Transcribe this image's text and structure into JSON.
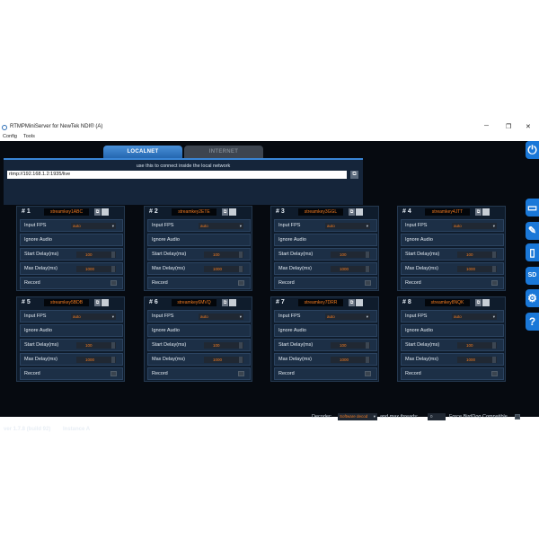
{
  "window": {
    "title": "RTMPMiniServer for NewTek NDI® (A)",
    "minimize": "─",
    "maximize": "❐",
    "close": "✕"
  },
  "menu": [
    "Config",
    "Tools"
  ],
  "tabs": [
    {
      "label": "LOCALNET",
      "active": true
    },
    {
      "label": "INTERNET",
      "active": false
    }
  ],
  "network": {
    "hint": "use this to connect inside the local network",
    "url": "rtmp://192.168.1.2:1935/live"
  },
  "field_labels": {
    "input_fps": "Input FPS",
    "ignore_audio": "Ignore Audio",
    "start_delay": "Start Delay(ms)",
    "max_delay": "Max Delay(ms)",
    "record": "Record"
  },
  "instances": [
    {
      "num": "# 1",
      "key": "streamkey1ABC",
      "fps": "auto",
      "start_delay": "100",
      "max_delay": "1000"
    },
    {
      "num": "# 2",
      "key": "streamkey2ETE",
      "fps": "auto",
      "start_delay": "100",
      "max_delay": "1000"
    },
    {
      "num": "# 3",
      "key": "streamkey3GGL",
      "fps": "auto",
      "start_delay": "100",
      "max_delay": "1000"
    },
    {
      "num": "# 4",
      "key": "streamkey4JTT",
      "fps": "auto",
      "start_delay": "100",
      "max_delay": "1000"
    },
    {
      "num": "# 5",
      "key": "streamkey5BDB",
      "fps": "auto",
      "start_delay": "100",
      "max_delay": "1000"
    },
    {
      "num": "# 6",
      "key": "streamkey6MVQ",
      "fps": "auto",
      "start_delay": "100",
      "max_delay": "1000"
    },
    {
      "num": "# 7",
      "key": "streamkey7DRR",
      "fps": "auto",
      "start_delay": "100",
      "max_delay": "1000"
    },
    {
      "num": "# 8",
      "key": "streamkey8NQK",
      "fps": "auto",
      "start_delay": "100",
      "max_delay": "1000"
    }
  ],
  "footer": {
    "decoder_label": "Decoder:",
    "decoder_value": "Software decod",
    "threads_label": "and max.threads:",
    "threads_value": "0",
    "birddog_label": "Force BirdDog Compatible",
    "version": "ver 1.7.8 (build 92)",
    "instance": "Instance A"
  },
  "sidebar": [
    {
      "icon": "power-icon",
      "glyph": "⏻"
    },
    {
      "icon": "monitor-icon",
      "glyph": "▭"
    },
    {
      "icon": "wrench-icon",
      "glyph": "✎"
    },
    {
      "icon": "mobile-icon",
      "glyph": "▯"
    },
    {
      "icon": "sdk-icon",
      "glyph": "SD"
    },
    {
      "icon": "gear-icon",
      "glyph": "⚙"
    },
    {
      "icon": "help-icon",
      "glyph": "?"
    }
  ],
  "colors": {
    "background": "#060a10",
    "panel": "#0f1c2c",
    "accent": "#1a78d8",
    "value": "#f07a20"
  }
}
